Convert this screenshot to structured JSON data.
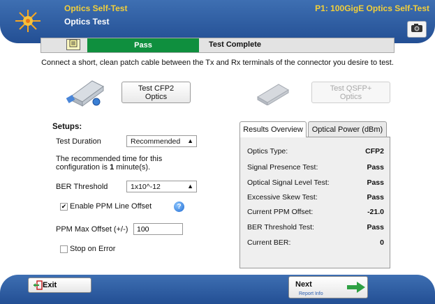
{
  "header": {
    "app_title": "Optics Self-Test",
    "sub_title": "Optics Test",
    "port_title": "P1: 100GigE Optics Self-Test",
    "logo_icon": "sunburst-logo-icon",
    "camera_icon": "camera-icon"
  },
  "status": {
    "result": "Pass",
    "message": "Test Complete",
    "pass_color": "#0f8f3e"
  },
  "instruction": "Connect a short, clean patch cable between the Tx and Rx terminals of the connector you desire to test.",
  "optics": {
    "cfp2_button": "Test CFP2 Optics",
    "qsfp_button": "Test QSFP+ Optics"
  },
  "setups": {
    "heading": "Setups:",
    "test_duration_label": "Test Duration",
    "test_duration_value": "Recommended",
    "recommended_text_line1": "The recommended time for this",
    "recommended_text_prefix": "configuration is",
    "recommended_minutes": "1",
    "recommended_text_suffix": "minute(s).",
    "ber_threshold_label": "BER Threshold",
    "ber_threshold_value": "1x10^-12",
    "enable_ppm_label": "Enable PPM Line Offset",
    "enable_ppm_checked": true,
    "ppm_max_label": "PPM Max Offset (+/-)",
    "ppm_max_value": "100",
    "stop_on_error_label": "Stop on Error",
    "stop_on_error_checked": false
  },
  "tabs": [
    {
      "label": "Results Overview",
      "active": true
    },
    {
      "label": "Optical Power (dBm)",
      "active": false
    }
  ],
  "results": [
    {
      "label": "Optics Type:",
      "value": "CFP2"
    },
    {
      "label": "Signal Presence Test:",
      "value": "Pass"
    },
    {
      "label": "Optical Signal Level Test:",
      "value": "Pass"
    },
    {
      "label": "Excessive Skew Test:",
      "value": "Pass"
    },
    {
      "label": "Current PPM Offset:",
      "value": "-21.0"
    },
    {
      "label": "BER Threshold Test:",
      "value": "Pass"
    },
    {
      "label": "Current BER:",
      "value": "0"
    }
  ],
  "footer": {
    "exit_label": "Exit",
    "next_label": "Next",
    "next_sub": "Report Info"
  }
}
